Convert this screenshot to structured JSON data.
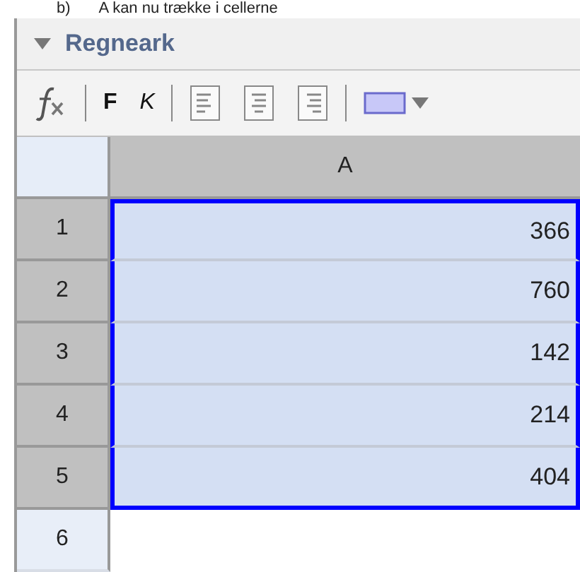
{
  "instruction": {
    "label": "b)",
    "text": "A kan nu trække i cellerne"
  },
  "panel": {
    "title": "Regneark"
  },
  "toolbar": [
    {
      "kind": "fx"
    },
    {
      "kind": "separator"
    },
    {
      "kind": "bold",
      "label": "F"
    },
    {
      "kind": "italic",
      "label": "K"
    },
    {
      "kind": "separator"
    },
    {
      "kind": "align-left"
    },
    {
      "kind": "align-center"
    },
    {
      "kind": "align-right"
    },
    {
      "kind": "separator"
    },
    {
      "kind": "color",
      "color": "#c8c8f8"
    }
  ],
  "table": {
    "columns": [
      "A"
    ],
    "rows": [
      {
        "number": "1",
        "value": "366",
        "selected": true
      },
      {
        "number": "2",
        "value": "760",
        "selected": true
      },
      {
        "number": "3",
        "value": "142",
        "selected": true
      },
      {
        "number": "4",
        "value": "214",
        "selected": true
      },
      {
        "number": "5",
        "value": "404",
        "selected": true
      },
      {
        "number": "6",
        "value": "",
        "selected": false
      }
    ]
  }
}
